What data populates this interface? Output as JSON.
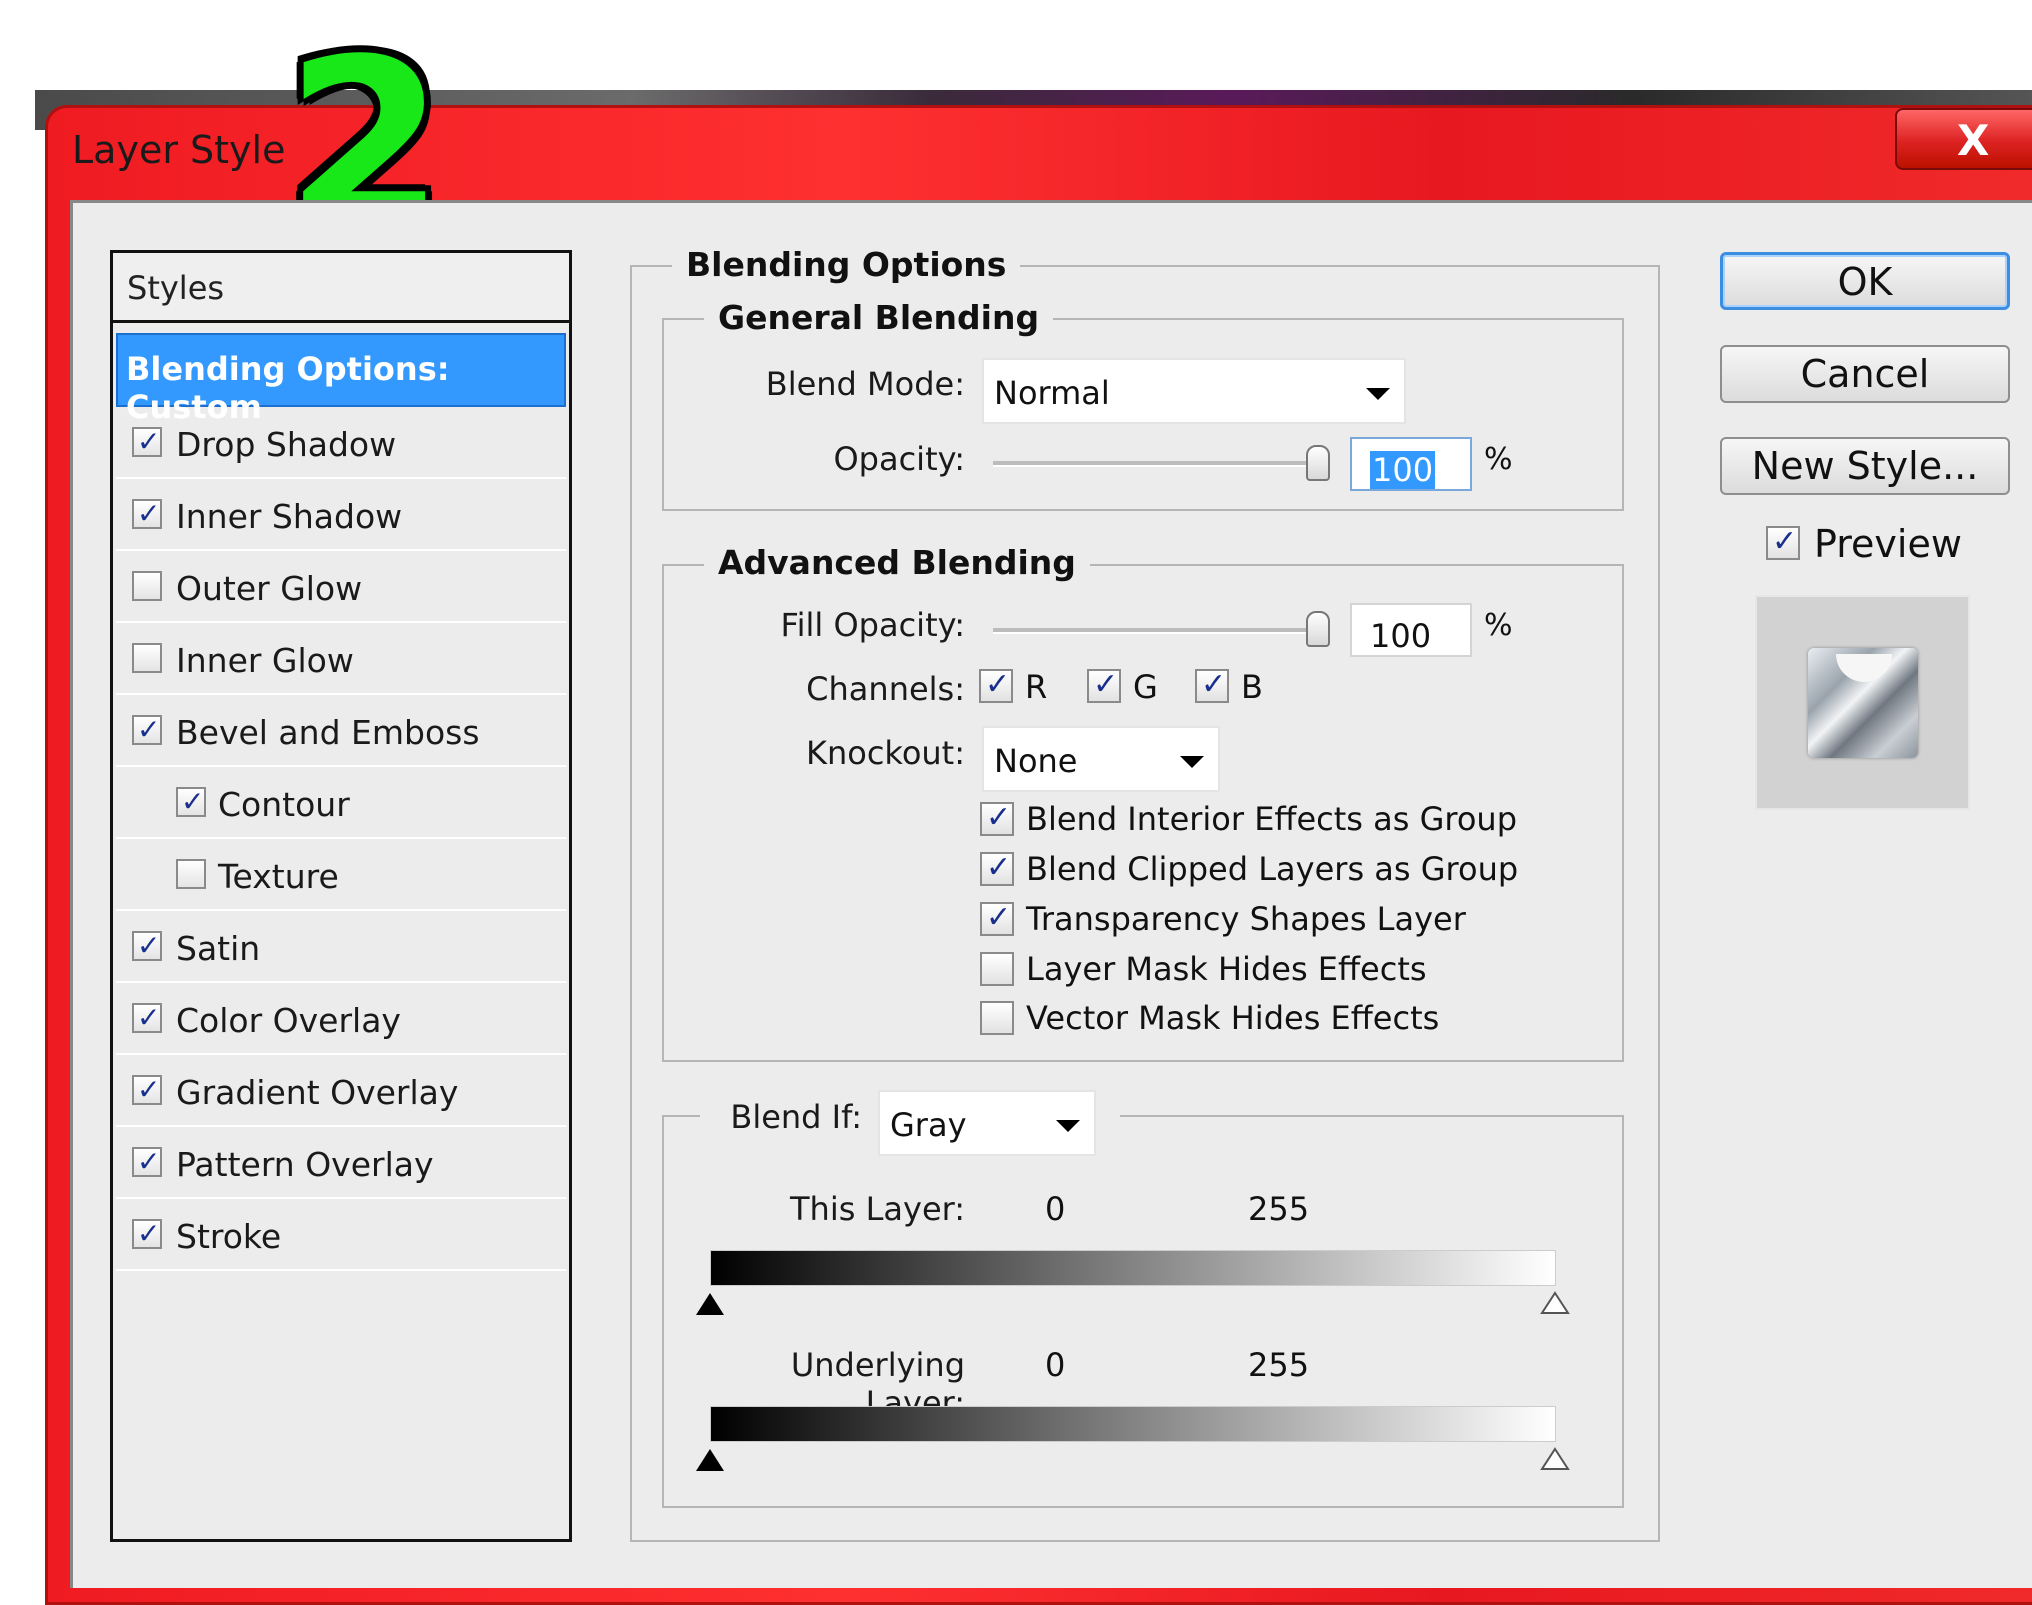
{
  "dialog": {
    "title": "Layer Style",
    "step_number": "2",
    "close_label": "X"
  },
  "styles_panel": {
    "header": "Styles",
    "selected": "Blending Options: Custom",
    "items": [
      {
        "label": "Drop Shadow",
        "checked": true
      },
      {
        "label": "Inner Shadow",
        "checked": true
      },
      {
        "label": "Outer Glow",
        "checked": false
      },
      {
        "label": "Inner Glow",
        "checked": false
      },
      {
        "label": "Bevel and Emboss",
        "checked": true
      },
      {
        "label": "Contour",
        "checked": true
      },
      {
        "label": "Texture",
        "checked": false
      },
      {
        "label": "Satin",
        "checked": true
      },
      {
        "label": "Color Overlay",
        "checked": true
      },
      {
        "label": "Gradient Overlay",
        "checked": true
      },
      {
        "label": "Pattern Overlay",
        "checked": true
      },
      {
        "label": "Stroke",
        "checked": true
      }
    ]
  },
  "blending_options": {
    "title": "Blending Options",
    "general": {
      "title": "General Blending",
      "blend_mode_label": "Blend Mode:",
      "blend_mode_value": "Normal",
      "opacity_label": "Opacity:",
      "opacity_value": "100",
      "percent": "%"
    },
    "advanced": {
      "title": "Advanced Blending",
      "fill_opacity_label": "Fill Opacity:",
      "fill_opacity_value": "100",
      "percent": "%",
      "channels_label": "Channels:",
      "channels": [
        {
          "label": "R",
          "checked": true
        },
        {
          "label": "G",
          "checked": true
        },
        {
          "label": "B",
          "checked": true
        }
      ],
      "knockout_label": "Knockout:",
      "knockout_value": "None",
      "options": [
        {
          "label": "Blend Interior Effects as Group",
          "checked": true
        },
        {
          "label": "Blend Clipped Layers as Group",
          "checked": true
        },
        {
          "label": "Transparency Shapes Layer",
          "checked": true
        },
        {
          "label": "Layer Mask Hides Effects",
          "checked": false
        },
        {
          "label": "Vector Mask Hides Effects",
          "checked": false
        }
      ]
    },
    "blend_if": {
      "label": "Blend If:",
      "value": "Gray",
      "this_layer_label": "This Layer:",
      "this_layer_min": "0",
      "this_layer_max": "255",
      "underlying_label": "Underlying Layer:",
      "underlying_min": "0",
      "underlying_max": "255"
    }
  },
  "buttons": {
    "ok": "OK",
    "cancel": "Cancel",
    "new_style": "New Style...",
    "preview_label": "Preview",
    "preview_checked": true
  }
}
